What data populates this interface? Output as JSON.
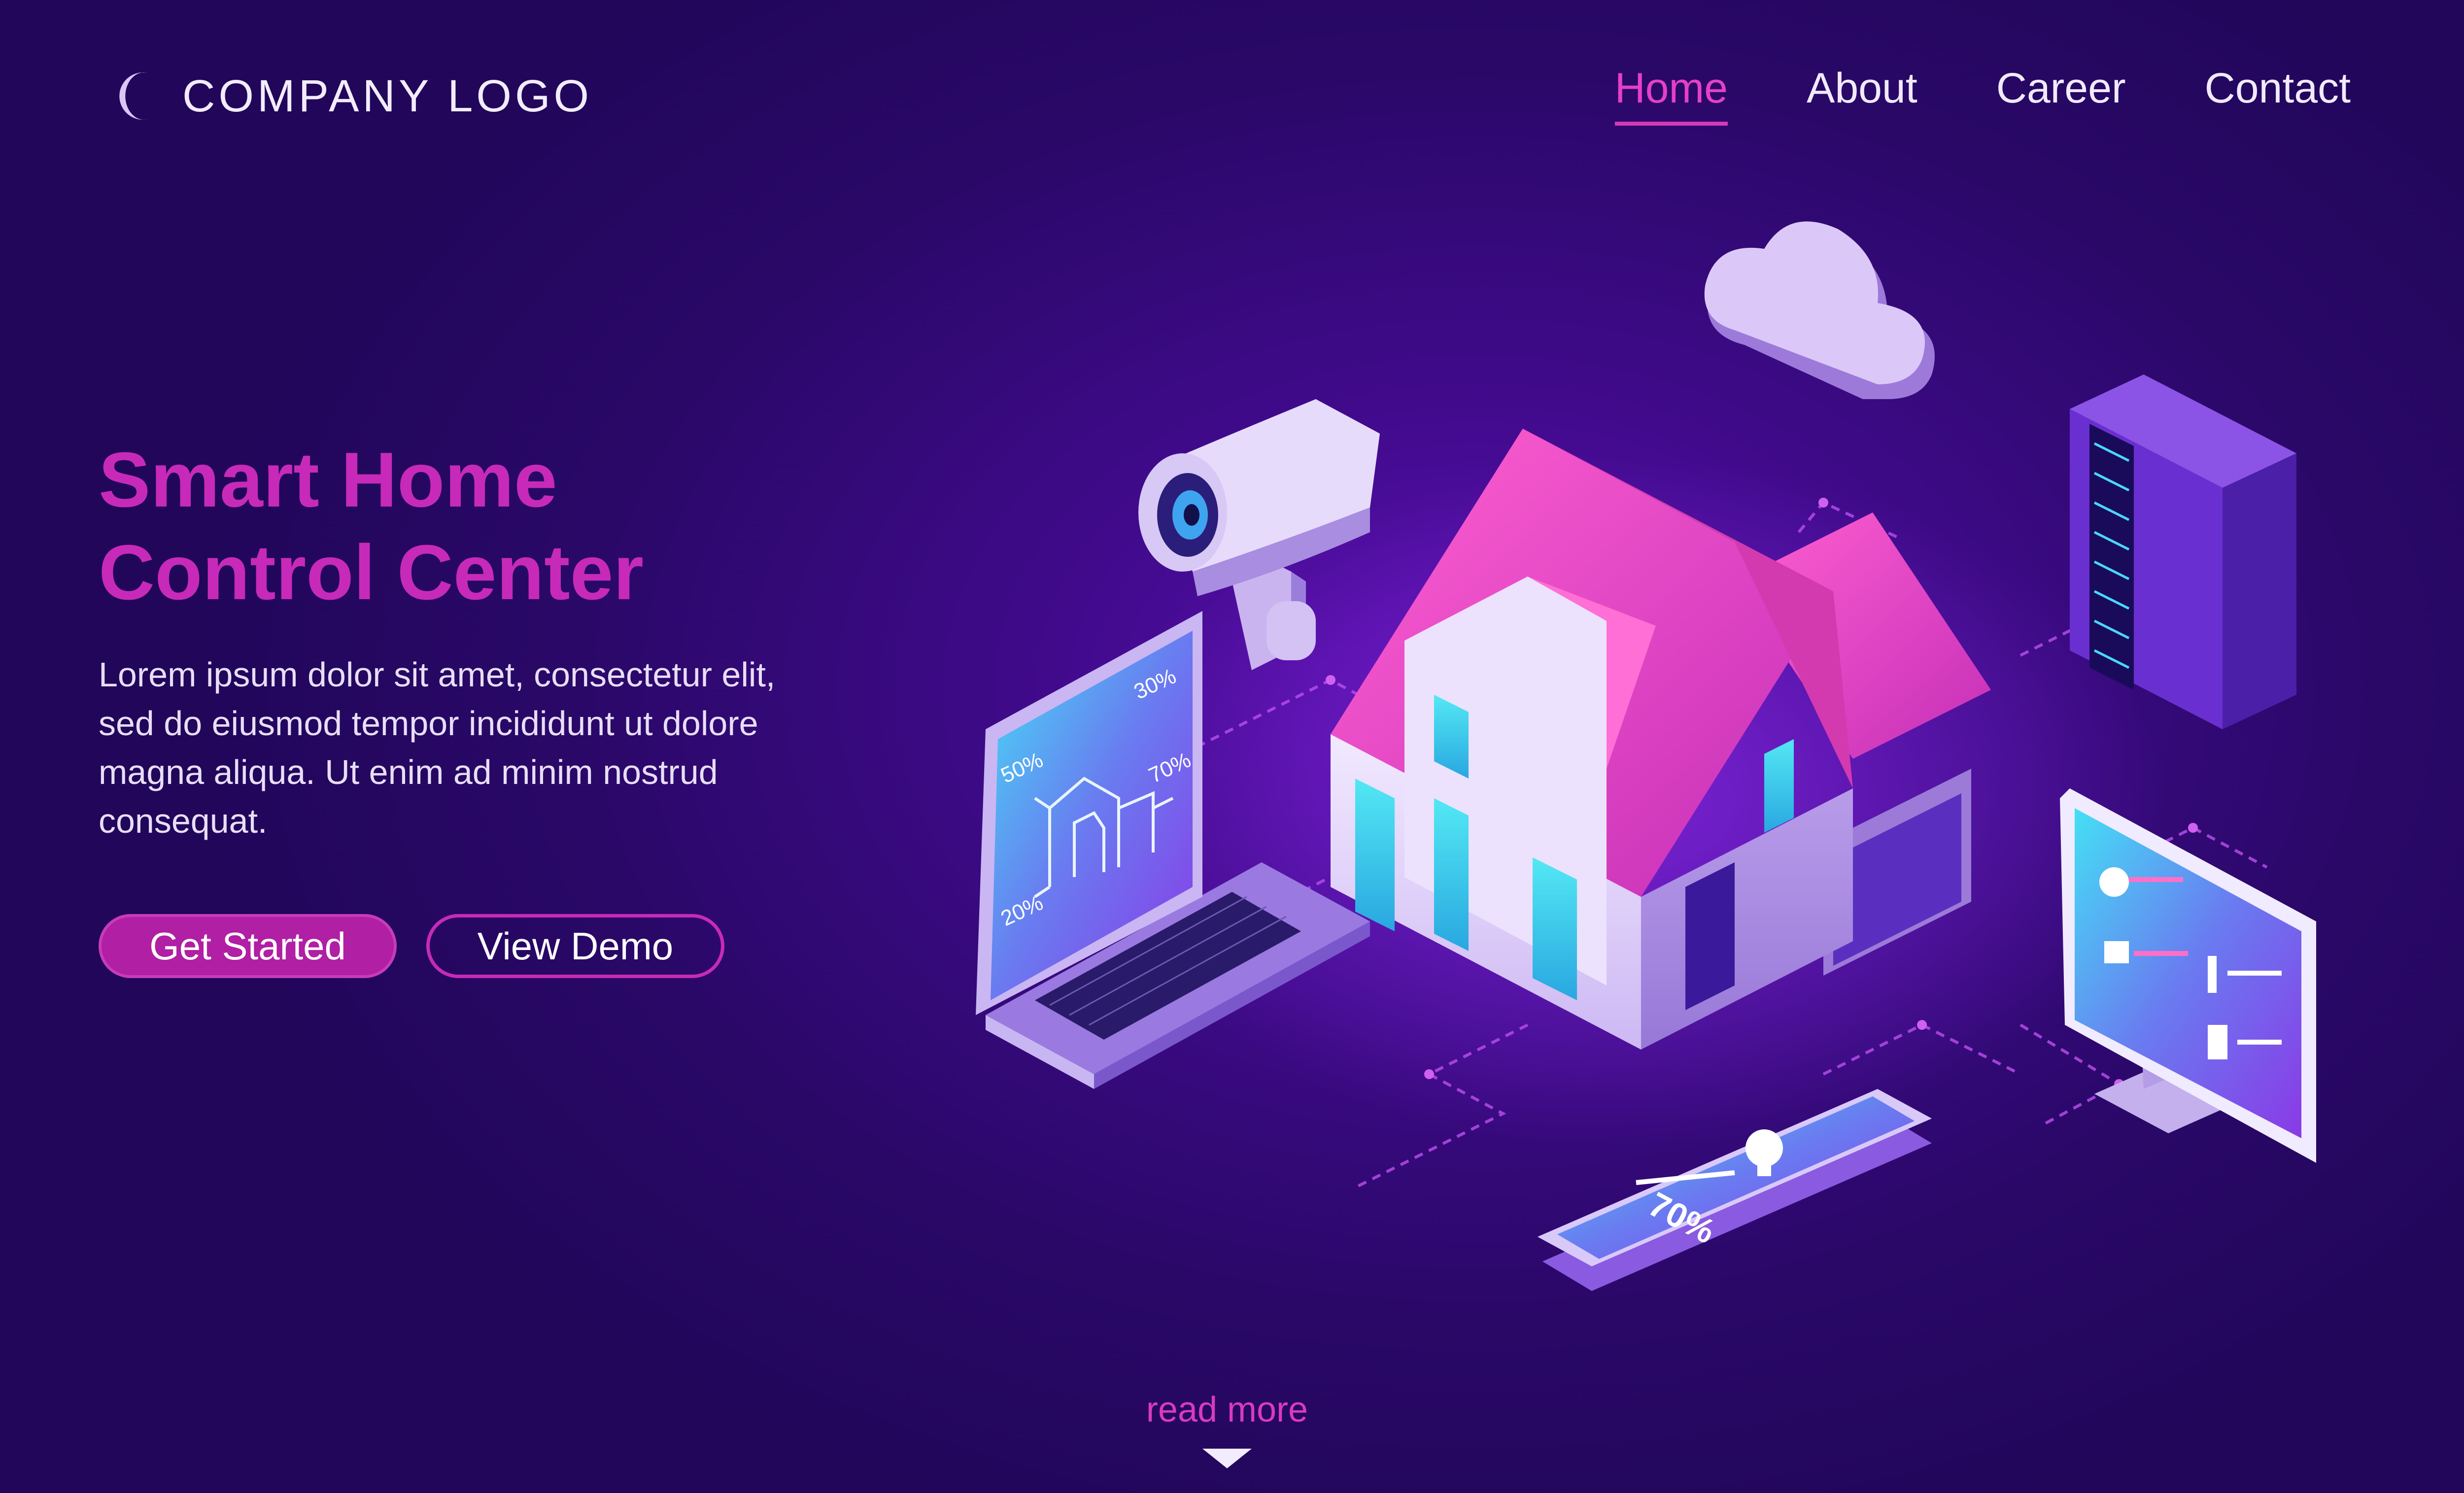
{
  "header": {
    "logo_text": "COMPANY LOGO",
    "logo_icon": "crescent-moon-icon",
    "nav": [
      {
        "label": "Home",
        "active": true
      },
      {
        "label": "About",
        "active": false
      },
      {
        "label": "Career",
        "active": false
      },
      {
        "label": "Contact",
        "active": false
      }
    ]
  },
  "hero": {
    "title_line1": "Smart Home",
    "title_line2": "Control Center",
    "description": "Lorem ipsum dolor sit amet, consectetur elit, sed do eiusmod tempor incididunt ut dolore magna aliqua. Ut enim ad minim nostrud consequat.",
    "primary_button": "Get Started",
    "secondary_button": "View Demo"
  },
  "illustration": {
    "laptop_labels": [
      "50%",
      "30%",
      "70%",
      "20%"
    ],
    "phone_value": "70%"
  },
  "footer": {
    "read_more": "read more"
  },
  "colors": {
    "accent": "#c72ab8",
    "background": "#2a0868",
    "roof": "#e040c0",
    "screen": "#3fd0f0"
  }
}
